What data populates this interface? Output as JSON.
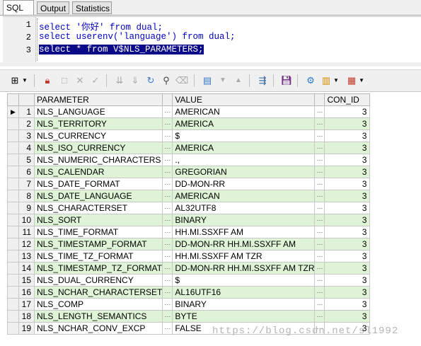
{
  "tabs": {
    "sql": "SQL",
    "output": "Output",
    "statistics": "Statistics"
  },
  "editor": {
    "lines": [
      {
        "no": "1",
        "text": "select '你好' from dual;"
      },
      {
        "no": "2",
        "text": "select userenv('language') from dual;"
      },
      {
        "no": "3",
        "text": "select * from V$NLS_PARAMETERS;"
      }
    ]
  },
  "grid": {
    "columns": [
      "PARAMETER",
      "VALUE",
      "CON_ID"
    ],
    "ellipsis": "···",
    "current_row_marker": "▶",
    "rows": [
      {
        "n": "1",
        "param": "NLS_LANGUAGE",
        "value": "AMERICAN",
        "con": "3"
      },
      {
        "n": "2",
        "param": "NLS_TERRITORY",
        "value": "AMERICA",
        "con": "3"
      },
      {
        "n": "3",
        "param": "NLS_CURRENCY",
        "value": "$",
        "con": "3"
      },
      {
        "n": "4",
        "param": "NLS_ISO_CURRENCY",
        "value": "AMERICA",
        "con": "3"
      },
      {
        "n": "5",
        "param": "NLS_NUMERIC_CHARACTERS",
        "value": ".,",
        "con": "3"
      },
      {
        "n": "6",
        "param": "NLS_CALENDAR",
        "value": "GREGORIAN",
        "con": "3"
      },
      {
        "n": "7",
        "param": "NLS_DATE_FORMAT",
        "value": "DD-MON-RR",
        "con": "3"
      },
      {
        "n": "8",
        "param": "NLS_DATE_LANGUAGE",
        "value": "AMERICAN",
        "con": "3"
      },
      {
        "n": "9",
        "param": "NLS_CHARACTERSET",
        "value": "AL32UTF8",
        "con": "3"
      },
      {
        "n": "10",
        "param": "NLS_SORT",
        "value": "BINARY",
        "con": "3"
      },
      {
        "n": "11",
        "param": "NLS_TIME_FORMAT",
        "value": "HH.MI.SSXFF AM",
        "con": "3"
      },
      {
        "n": "12",
        "param": "NLS_TIMESTAMP_FORMAT",
        "value": "DD-MON-RR HH.MI.SSXFF AM",
        "con": "3"
      },
      {
        "n": "13",
        "param": "NLS_TIME_TZ_FORMAT",
        "value": "HH.MI.SSXFF AM TZR",
        "con": "3"
      },
      {
        "n": "14",
        "param": "NLS_TIMESTAMP_TZ_FORMAT",
        "value": "DD-MON-RR HH.MI.SSXFF AM TZR",
        "con": "3"
      },
      {
        "n": "15",
        "param": "NLS_DUAL_CURRENCY",
        "value": "$",
        "con": "3"
      },
      {
        "n": "16",
        "param": "NLS_NCHAR_CHARACTERSET",
        "value": "AL16UTF16",
        "con": "3"
      },
      {
        "n": "17",
        "param": "NLS_COMP",
        "value": "BINARY",
        "con": "3"
      },
      {
        "n": "18",
        "param": "NLS_LENGTH_SEMANTICS",
        "value": "BYTE",
        "con": "3"
      },
      {
        "n": "19",
        "param": "NLS_NCHAR_CONV_EXCP",
        "value": "FALSE",
        "con": "3"
      }
    ]
  },
  "watermark": "https://blog.csdn.net/sl1992",
  "colors": {
    "alt_row": "#dff3d6",
    "selection": "#0a0a88",
    "code": "#0000c0"
  }
}
